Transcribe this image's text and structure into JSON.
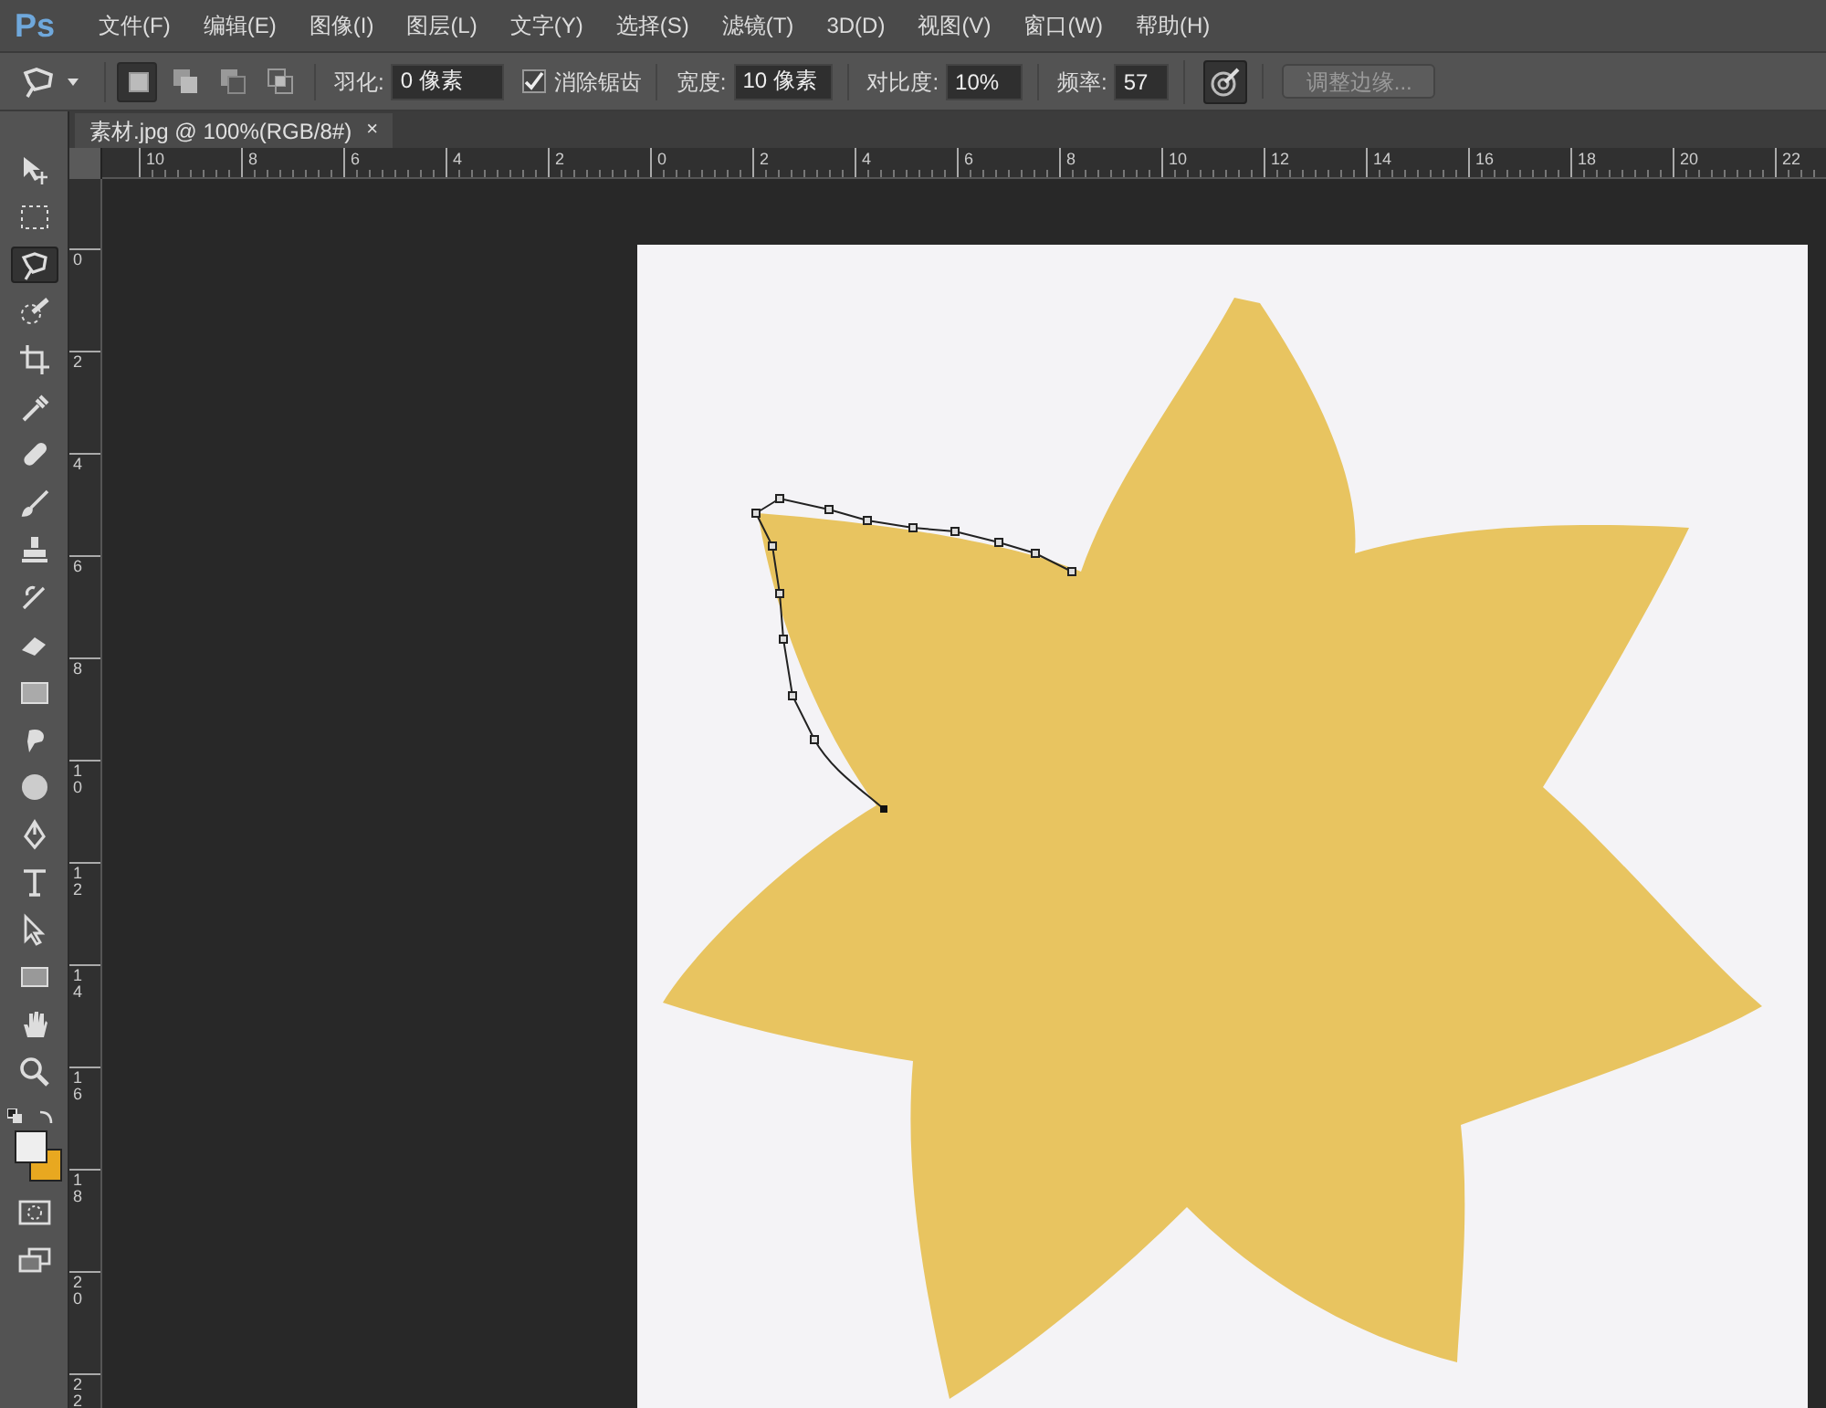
{
  "app": {
    "logo": "Ps"
  },
  "menu": [
    "文件(F)",
    "编辑(E)",
    "图像(I)",
    "图层(L)",
    "文字(Y)",
    "选择(S)",
    "滤镜(T)",
    "3D(D)",
    "视图(V)",
    "窗口(W)",
    "帮助(H)"
  ],
  "options_bar": {
    "modes": [
      {
        "kind": "new",
        "selected": true
      },
      {
        "kind": "add",
        "selected": false
      },
      {
        "kind": "subtract",
        "selected": false
      },
      {
        "kind": "intersect",
        "selected": false
      }
    ],
    "feather": {
      "label": "羽化:",
      "value": "0 像素"
    },
    "antialias": {
      "label": "消除锯齿",
      "checked": true
    },
    "width": {
      "label": "宽度:",
      "value": "10 像素"
    },
    "contrast": {
      "label": "对比度:",
      "value": "10%"
    },
    "frequency": {
      "label": "频率:",
      "value": "57"
    },
    "pressure": {
      "selected": true
    },
    "refine_button": {
      "label": "调整边缘...",
      "disabled": true
    }
  },
  "document_tab": {
    "title": "素材.jpg @ 100%(RGB/8#)",
    "close": "×"
  },
  "ruler_h": [
    "10",
    "8",
    "6",
    "4",
    "2",
    "0",
    "2",
    "4",
    "6",
    "8",
    "10",
    "12",
    "14",
    "16",
    "18",
    "20",
    "22"
  ],
  "ruler_v": [
    "0",
    "2",
    "4",
    "6",
    "8",
    "10",
    "12",
    "14",
    "16",
    "18",
    "20",
    "22"
  ],
  "toolz": [
    {
      "kind": "move",
      "selected": false
    },
    {
      "kind": "marquee",
      "selected": false
    },
    {
      "kind": "lasso",
      "selected": true
    },
    {
      "kind": "quick",
      "selected": false
    },
    {
      "kind": "crop",
      "selected": false
    },
    {
      "kind": "eyedropper",
      "selected": false
    },
    {
      "kind": "heal",
      "selected": false
    },
    {
      "kind": "brush",
      "selected": false
    },
    {
      "kind": "stamp",
      "selected": false
    },
    {
      "kind": "history",
      "selected": false
    },
    {
      "kind": "eraser",
      "selected": false
    },
    {
      "kind": "gradient",
      "selected": false
    },
    {
      "kind": "blur",
      "selected": false
    },
    {
      "kind": "dodge",
      "selected": false
    },
    {
      "kind": "pen",
      "selected": false
    },
    {
      "kind": "type",
      "selected": false
    },
    {
      "kind": "select",
      "selected": false
    },
    {
      "kind": "rect",
      "selected": false
    },
    {
      "kind": "hand",
      "selected": false
    },
    {
      "kind": "zoom",
      "selected": false
    }
  ]
}
